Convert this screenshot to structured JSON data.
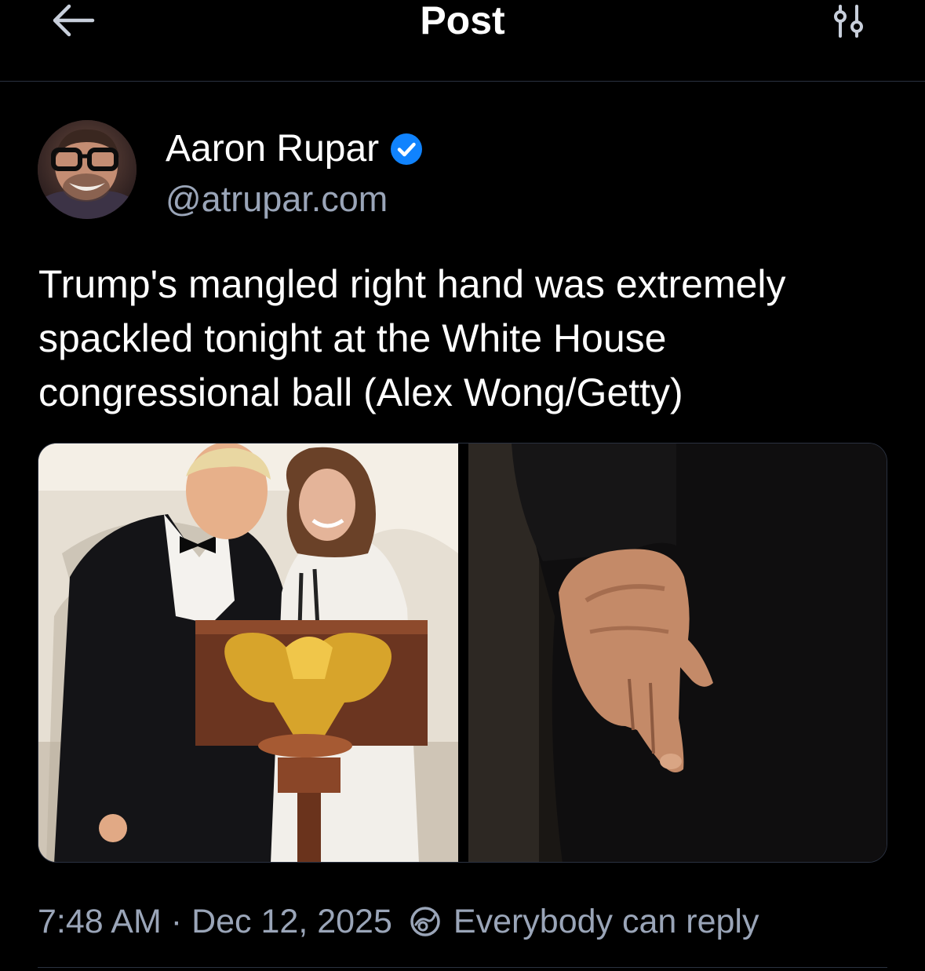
{
  "header": {
    "title": "Post",
    "back_icon": "arrow-left-icon",
    "settings_icon": "filter-sliders-icon"
  },
  "author": {
    "display_name": "Aaron Rupar",
    "handle": "@atrupar.com",
    "verified": true,
    "verified_color": "#1083fe"
  },
  "post": {
    "text": "Trump's mangled right hand was extremely spackled tonight at the White House congressional ball (Alex Wong/Getty)"
  },
  "footer": {
    "time": "7:48 AM",
    "separator": "·",
    "date": "Dec 12, 2025",
    "reply_setting": "Everybody can reply",
    "reply_icon": "reply-permission-icon"
  },
  "colors": {
    "background": "#000000",
    "text_primary": "#ffffff",
    "text_secondary": "#9aa5b8",
    "divider": "#2a3140",
    "accent": "#1083fe"
  }
}
